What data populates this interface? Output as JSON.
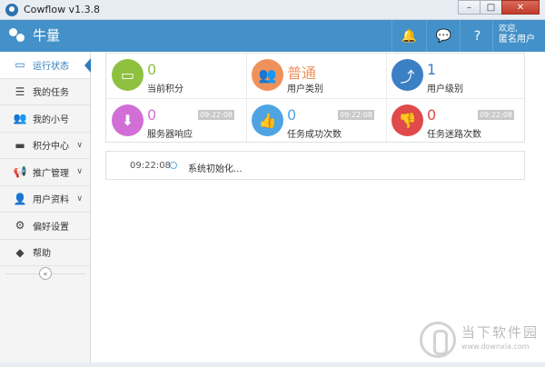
{
  "window": {
    "title": "Cowflow v1.3.8",
    "min_glyph": "–",
    "max_glyph": "□",
    "close_glyph": "✕"
  },
  "header": {
    "brand": "牛量",
    "welcome_line1": "欢迎,",
    "welcome_line2": "匿名用户",
    "accent": "#4391c8"
  },
  "sidebar": {
    "items": [
      {
        "label": "运行状态",
        "icon": "monitor-icon",
        "glyph": "▭",
        "active": true
      },
      {
        "label": "我的任务",
        "icon": "task-list-icon",
        "glyph": "☰"
      },
      {
        "label": "我的小号",
        "icon": "users-icon",
        "glyph": "👥"
      },
      {
        "label": "积分中心",
        "icon": "credit-card-icon",
        "glyph": "▬",
        "chevron": "∨"
      },
      {
        "label": "推广管理",
        "icon": "megaphone-icon",
        "glyph": "📢",
        "chevron": "∨"
      },
      {
        "label": "用户资料",
        "icon": "user-icon",
        "glyph": "👤",
        "chevron": "∨"
      },
      {
        "label": "偏好设置",
        "icon": "gears-icon",
        "glyph": "⚙"
      },
      {
        "label": "帮助",
        "icon": "tag-icon",
        "glyph": "◆"
      }
    ],
    "collapse_glyph": "«"
  },
  "stats": [
    {
      "value": "0",
      "label": "当前积分",
      "color": "#8dc13f",
      "glyph": "▭",
      "icon": "card-icon",
      "time": ""
    },
    {
      "value": "普通",
      "label": "用户类别",
      "color": "#f0915c",
      "glyph": "👥",
      "icon": "group-icon",
      "time": ""
    },
    {
      "value": "1",
      "label": "用户级别",
      "color": "#3b7fc4",
      "glyph": "⤴",
      "icon": "level-up-icon",
      "time": ""
    },
    {
      "value": "0",
      "label": "服务器响应",
      "color": "#d16fd6",
      "glyph": "⬇",
      "icon": "download-icon",
      "time": "09:22:08"
    },
    {
      "value": "0",
      "label": "任务成功次数",
      "color": "#4ea4e3",
      "glyph": "👍",
      "icon": "thumbs-up-icon",
      "time": "09:22:08"
    },
    {
      "value": "0",
      "label": "任务迷路次数",
      "color": "#e04a4a",
      "glyph": "👎",
      "icon": "thumbs-down-icon",
      "time": "09:22:08"
    }
  ],
  "log": {
    "time": "09:22:08",
    "message": "系统初始化..."
  },
  "watermark": {
    "line1": "当下软件园",
    "line2": "www.downxia.com"
  }
}
